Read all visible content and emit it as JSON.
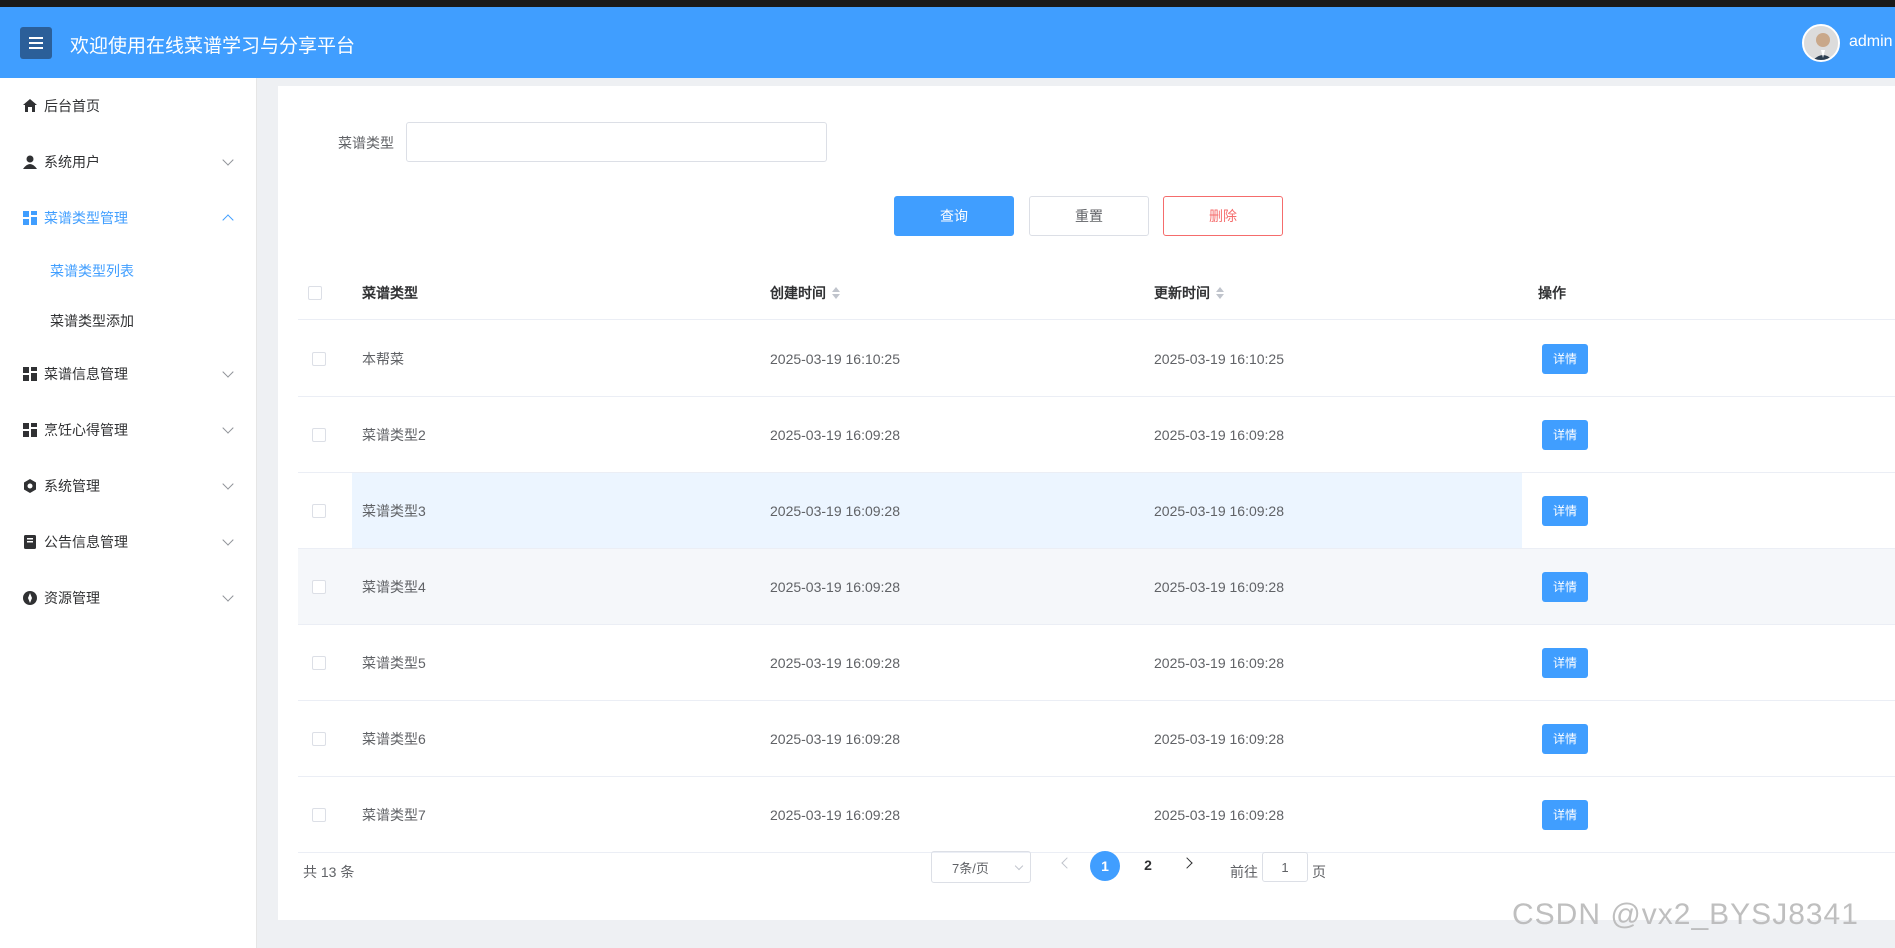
{
  "header": {
    "title": "欢迎使用在线菜谱学习与分享平台",
    "username": "admin"
  },
  "sidebar": {
    "items": [
      {
        "label": "后台首页",
        "icon": "home-icon"
      },
      {
        "label": "系统用户",
        "icon": "user-icon"
      },
      {
        "label": "菜谱类型管理",
        "icon": "grid-icon",
        "expanded": true
      },
      {
        "label": "菜谱信息管理",
        "icon": "grid-icon"
      },
      {
        "label": "烹饪心得管理",
        "icon": "grid-icon"
      },
      {
        "label": "系统管理",
        "icon": "gear-icon"
      },
      {
        "label": "公告信息管理",
        "icon": "document-icon"
      },
      {
        "label": "资源管理",
        "icon": "compass-icon"
      }
    ],
    "subitems": [
      {
        "label": "菜谱类型列表",
        "active": true
      },
      {
        "label": "菜谱类型添加",
        "active": false
      }
    ]
  },
  "filter": {
    "label": "菜谱类型",
    "value": ""
  },
  "buttons": {
    "query": "查询",
    "reset": "重置",
    "delete": "删除"
  },
  "table": {
    "columns": [
      "菜谱类型",
      "创建时间",
      "更新时间",
      "操作"
    ],
    "detail_label": "详情",
    "rows": [
      {
        "type": "本帮菜",
        "created": "2025-03-19 16:10:25",
        "updated": "2025-03-19 16:10:25"
      },
      {
        "type": "菜谱类型2",
        "created": "2025-03-19 16:09:28",
        "updated": "2025-03-19 16:09:28"
      },
      {
        "type": "菜谱类型3",
        "created": "2025-03-19 16:09:28",
        "updated": "2025-03-19 16:09:28"
      },
      {
        "type": "菜谱类型4",
        "created": "2025-03-19 16:09:28",
        "updated": "2025-03-19 16:09:28"
      },
      {
        "type": "菜谱类型5",
        "created": "2025-03-19 16:09:28",
        "updated": "2025-03-19 16:09:28"
      },
      {
        "type": "菜谱类型6",
        "created": "2025-03-19 16:09:28",
        "updated": "2025-03-19 16:09:28"
      },
      {
        "type": "菜谱类型7",
        "created": "2025-03-19 16:09:28",
        "updated": "2025-03-19 16:09:28"
      }
    ]
  },
  "pagination": {
    "total": "共 13 条",
    "page_size": "7条/页",
    "pages": [
      "1",
      "2"
    ],
    "current": "1",
    "goto_label": "前往",
    "goto_value": "1",
    "goto_suffix": "页"
  },
  "watermark": "CSDN @vx2_BYSJ8341",
  "colors": {
    "primary": "#409eff",
    "danger": "#f56c6c"
  }
}
